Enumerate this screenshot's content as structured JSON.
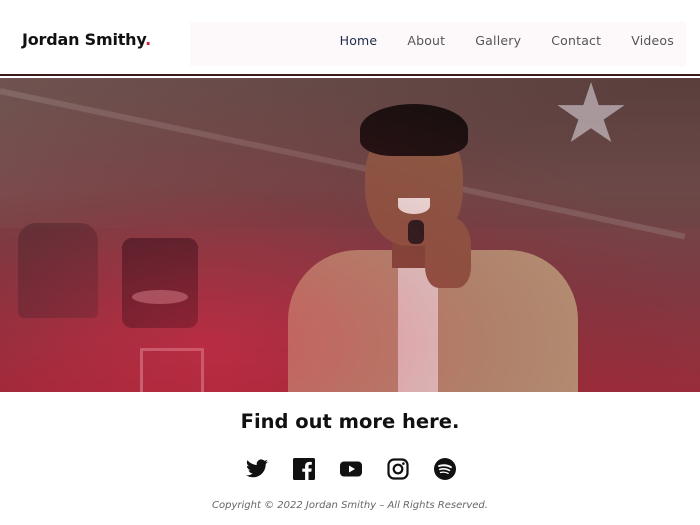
{
  "header": {
    "logo_text": "Jordan Smithy",
    "logo_dot": ".",
    "nav": [
      {
        "label": "Home",
        "active": true
      },
      {
        "label": "About",
        "active": false
      },
      {
        "label": "Gallery",
        "active": false
      },
      {
        "label": "Contact",
        "active": false
      },
      {
        "label": "Videos",
        "active": false
      }
    ]
  },
  "hero": {
    "image": "singer-on-stage-photo"
  },
  "cta": {
    "heading": "Find out more here."
  },
  "socials": [
    {
      "name": "twitter-icon"
    },
    {
      "name": "facebook-icon"
    },
    {
      "name": "youtube-icon"
    },
    {
      "name": "instagram-icon"
    },
    {
      "name": "spotify-icon"
    }
  ],
  "footer": {
    "copyright": "Copyright © 2022 Jordan Smithy – All Rights Reserved."
  },
  "colors": {
    "accent": "#d21f3c",
    "nav_active": "#1c2c4a",
    "text": "#111111"
  }
}
